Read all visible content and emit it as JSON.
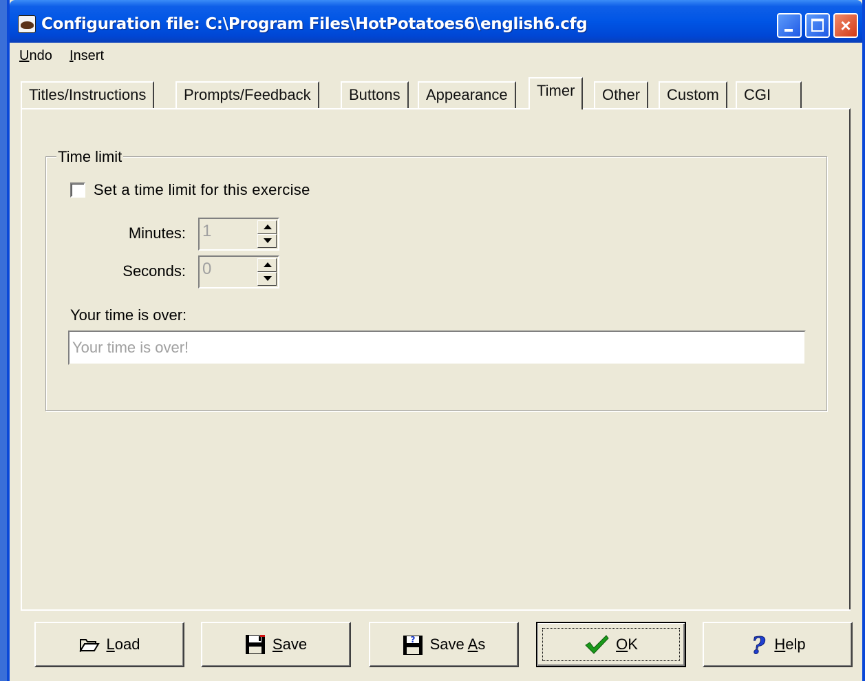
{
  "window": {
    "title": "Configuration file: C:\\Program Files\\HotPotatoes6\\english6.cfg",
    "close_glyph": "×"
  },
  "menu": {
    "undo": {
      "accel": "U",
      "rest": "ndo"
    },
    "insert": {
      "accel": "I",
      "rest": "nsert"
    }
  },
  "tabs": [
    {
      "label": "Titles/Instructions",
      "active": false
    },
    {
      "label": "Prompts/Feedback",
      "active": false
    },
    {
      "label": "Buttons",
      "active": false
    },
    {
      "label": "Appearance",
      "active": false
    },
    {
      "label": "Timer",
      "active": true
    },
    {
      "label": "Other",
      "active": false
    },
    {
      "label": "Custom",
      "active": false
    },
    {
      "label": "CGI",
      "active": false
    }
  ],
  "timer": {
    "group_title": "Time limit",
    "checkbox_label": "Set a time limit for this exercise",
    "checkbox_checked": false,
    "minutes_label": "Minutes:",
    "minutes_value": "1",
    "seconds_label": "Seconds:",
    "seconds_value": "0",
    "over_label": "Your time is over:",
    "over_value": "Your time is over!"
  },
  "buttons": {
    "load": {
      "accel": "L",
      "rest": "oad"
    },
    "save": {
      "accel": "S",
      "rest": "ave"
    },
    "save_as": {
      "pre": "Save ",
      "accel": "A",
      "rest": "s"
    },
    "ok": {
      "accel": "O",
      "rest": "K"
    },
    "help": {
      "accel": "H",
      "rest": "elp"
    }
  },
  "colors": {
    "titlebar": "#0055e5",
    "face": "#ece9d8",
    "ok_check": "#1a9a1a",
    "help_icon": "#1f3fd0",
    "save_red": "#d01010"
  }
}
